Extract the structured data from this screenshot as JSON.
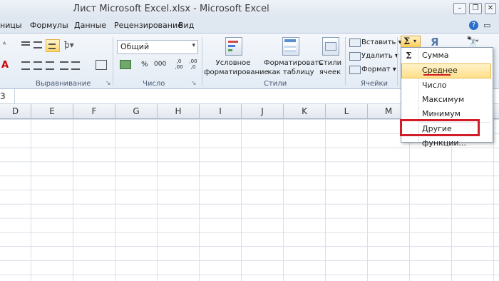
{
  "window": {
    "title": "Лист Microsoft Excel.xlsx - Microsoft Excel"
  },
  "menu": {
    "tabs": [
      "ницы",
      "Формулы",
      "Данные",
      "Рецензирование",
      "Вид"
    ]
  },
  "ribbon": {
    "number_format_value": "Общий",
    "groups": {
      "alignment": "Выравнивание",
      "number": "Число",
      "styles": "Стили",
      "cells": "Ячейки"
    },
    "styles": {
      "conditional_line1": "Условное",
      "conditional_line2": "форматирование",
      "format_table_line1": "Форматировать",
      "format_table_line2": "как таблицу",
      "cell_styles_line1": "Стили",
      "cell_styles_line2": "ячеек"
    },
    "cells": {
      "insert": "Вставить",
      "delete": "Удалить",
      "format": "Формат"
    },
    "number_buttons": {
      "percent": "%",
      "thousands": "000",
      "inc_decimal": ",0 ,00",
      "dec_decimal": ",00 ,0"
    }
  },
  "formula_bar": {
    "name_box_fragment": "3"
  },
  "columns": [
    "D",
    "E",
    "F",
    "G",
    "H",
    "I",
    "J",
    "K",
    "L",
    "M"
  ],
  "autosum_menu": {
    "button_symbol": "Σ",
    "items": [
      {
        "label": "Сумма",
        "icon": "Σ"
      },
      {
        "label": "Среднее",
        "icon": ""
      },
      {
        "label": "Число",
        "icon": ""
      },
      {
        "label": "Максимум",
        "icon": ""
      },
      {
        "label": "Минимум",
        "icon": ""
      },
      {
        "label": "Другие функции...",
        "icon": ""
      }
    ]
  },
  "colors": {
    "highlight": "#ffe08a",
    "annotation_red": "#d21c28",
    "ribbon_bg": "#e3ebf5"
  }
}
